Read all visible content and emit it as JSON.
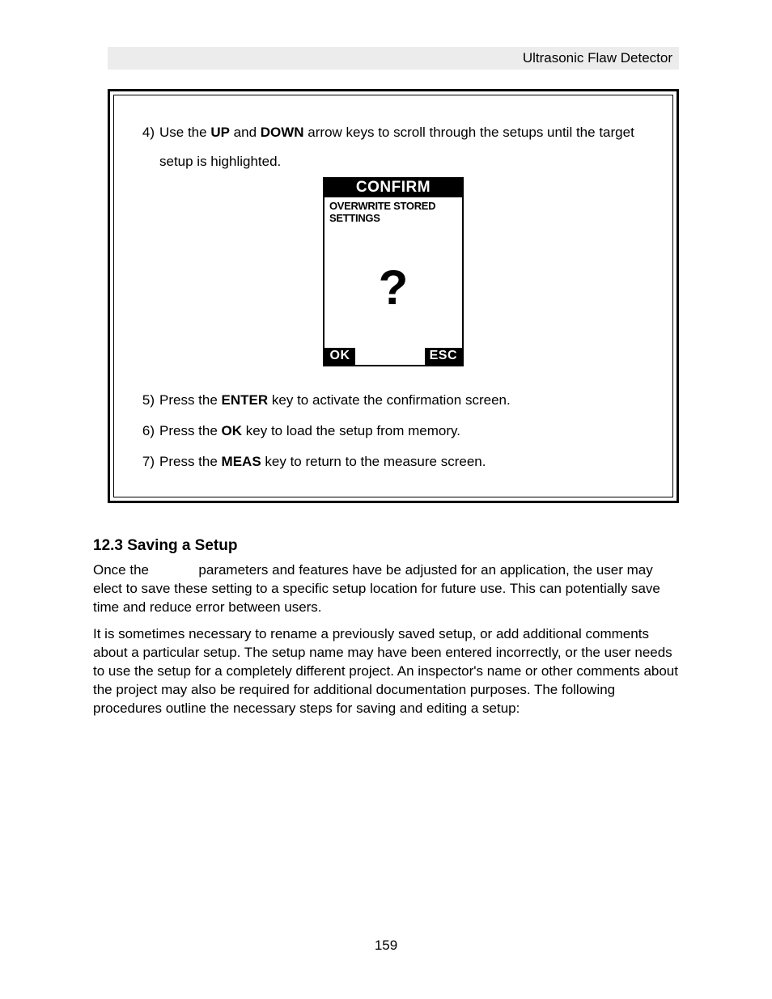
{
  "header": {
    "title": "Ultrasonic Flaw Detector"
  },
  "steps": {
    "s4": {
      "num": "4)",
      "pre": "Use the ",
      "b1": "UP",
      "mid": " and ",
      "b2": "DOWN",
      "post": " arrow keys to scroll through the setups until the target setup is highlighted."
    },
    "s5": {
      "num": "5)",
      "pre": "Press the ",
      "b1": "ENTER",
      "post": " key to activate the confirmation screen."
    },
    "s6": {
      "num": "6)",
      "pre": "Press the ",
      "b1": "OK",
      "post": " key to load the setup from memory."
    },
    "s7": {
      "num": "7)",
      "pre": "Press the ",
      "b1": "MEAS",
      "post": " key to return to the measure screen."
    }
  },
  "dialog": {
    "title": "CONFIRM",
    "message_l1": "OVERWRITE STORED",
    "message_l2": "SETTINGS",
    "qmark": "?",
    "ok": "OK",
    "esc": "ESC"
  },
  "section": {
    "heading": "12.3 Saving a Setup"
  },
  "paragraphs": {
    "p1a": "Once the ",
    "p1b": " parameters and features have be adjusted for an application, the user may elect to save these setting to a specific setup location for future use.  This can potentially save time and reduce error between users.",
    "p2": "It is sometimes necessary to rename a previously saved setup, or add additional comments about a particular setup.  The setup name may have been entered incorrectly, or the user needs to use the setup for a completely different project.  An inspector's name or other comments about the project may also be required for additional documentation purposes.  The following procedures outline the necessary steps for saving and editing a setup:"
  },
  "page_number": "159"
}
